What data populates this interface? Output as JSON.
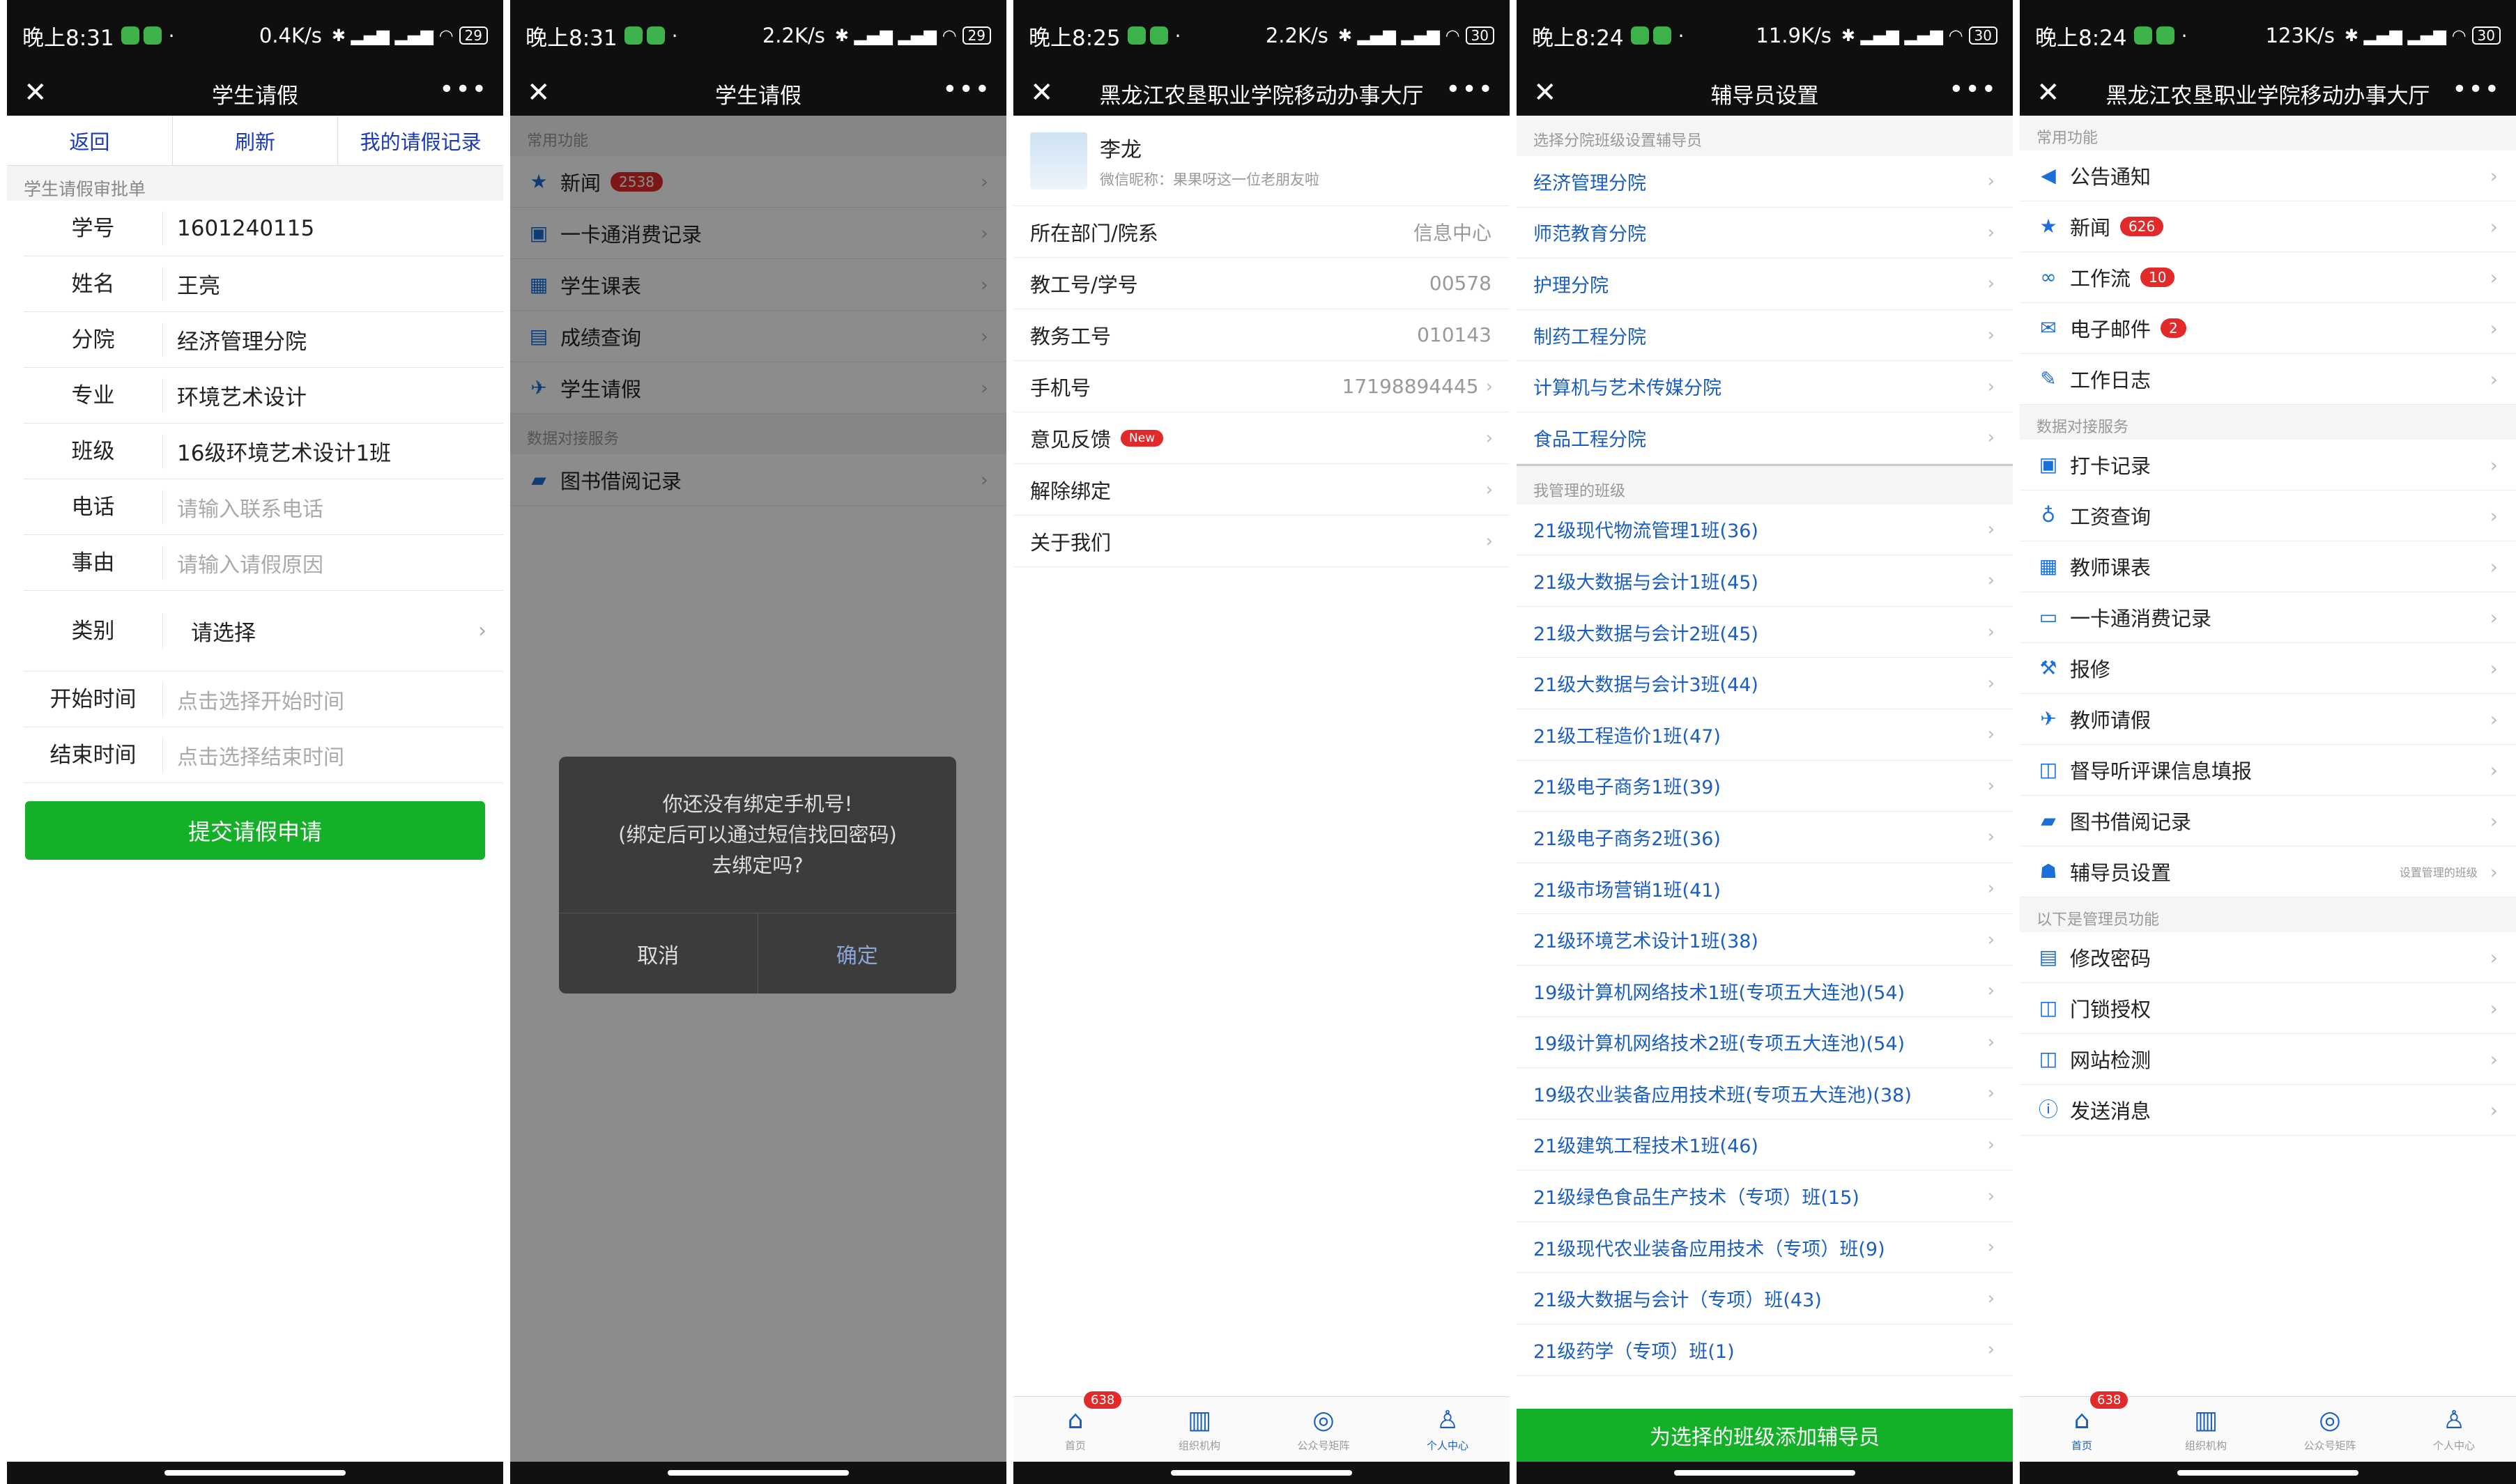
{
  "screens": [
    {
      "status": {
        "time": "晚上8:31",
        "speed": "0.4K/s",
        "battery": "29"
      },
      "nav": {
        "title": "学生请假"
      },
      "buttons": [
        "返回",
        "刷新",
        "我的请假记录"
      ],
      "form_title": "学生请假审批单",
      "fields": {
        "student_id": {
          "label": "学号",
          "value": "1601240115"
        },
        "name": {
          "label": "姓名",
          "value": "王亮"
        },
        "branch": {
          "label": "分院",
          "value": "经济管理分院"
        },
        "major": {
          "label": "专业",
          "value": "环境艺术设计"
        },
        "class": {
          "label": "班级",
          "value": "16级环境艺术设计1班"
        },
        "phone": {
          "label": "电话",
          "placeholder": "请输入联系电话"
        },
        "reason": {
          "label": "事由",
          "placeholder": "请输入请假原因"
        },
        "category": {
          "label": "类别",
          "value": "请选择"
        },
        "start_time": {
          "label": "开始时间",
          "placeholder": "点击选择开始时间"
        },
        "end_time": {
          "label": "结束时间",
          "placeholder": "点击选择结束时间"
        }
      },
      "submit_label": "提交请假申请"
    },
    {
      "status": {
        "time": "晚上8:31",
        "speed": "2.2K/s",
        "battery": "29"
      },
      "nav": {
        "title": "学生请假"
      },
      "section1": "常用功能",
      "items1": [
        {
          "label": "新闻",
          "badge": "2538"
        },
        {
          "label": "一卡通消费记录"
        },
        {
          "label": "学生课表"
        },
        {
          "label": "成绩查询"
        },
        {
          "label": "学生请假"
        }
      ],
      "section2": "数据对接服务",
      "items2": [
        {
          "label": "图书借阅记录"
        }
      ],
      "dialog": {
        "line1": "你还没有绑定手机号!",
        "line2": "(绑定后可以通过短信找回密码)",
        "line3": "去绑定吗?",
        "cancel": "取消",
        "confirm": "确定"
      }
    },
    {
      "status": {
        "time": "晚上8:25",
        "speed": "2.2K/s",
        "battery": "30"
      },
      "nav": {
        "title": "黑龙江农垦职业学院移动办事大厅"
      },
      "profile": {
        "name": "李龙",
        "nickname": "微信昵称：果果呀这一位老朋友啦"
      },
      "rows": [
        {
          "label": "所在部门/院系",
          "value": "信息中心"
        },
        {
          "label": "教工号/学号",
          "value": "00578"
        },
        {
          "label": "教务工号",
          "value": "010143"
        },
        {
          "label": "手机号",
          "value": "17198894445"
        },
        {
          "label": "意见反馈",
          "badge": "New"
        },
        {
          "label": "解除绑定"
        },
        {
          "label": "关于我们"
        }
      ],
      "tabs": [
        {
          "label": "首页",
          "badge": "638"
        },
        {
          "label": "组织机构"
        },
        {
          "label": "公众号矩阵"
        },
        {
          "label": "个人中心"
        }
      ]
    },
    {
      "status": {
        "time": "晚上8:24",
        "speed": "11.9K/s",
        "battery": "30"
      },
      "nav": {
        "title": "辅导员设置"
      },
      "section1": "选择分院班级设置辅导员",
      "branches": [
        "经济管理分院",
        "师范教育分院",
        "护理分院",
        "制药工程分院",
        "计算机与艺术传媒分院",
        "食品工程分院"
      ],
      "section2": "我管理的班级",
      "classes": [
        "21级现代物流管理1班(36)",
        "21级大数据与会计1班(45)",
        "21级大数据与会计2班(45)",
        "21级大数据与会计3班(44)",
        "21级工程造价1班(47)",
        "21级电子商务1班(39)",
        "21级电子商务2班(36)",
        "21级市场营销1班(41)",
        "21级环境艺术设计1班(38)",
        "19级计算机网络技术1班(专项五大连池)(54)",
        "19级计算机网络技术2班(专项五大连池)(54)",
        "19级农业装备应用技术班(专项五大连池)(38)",
        "21级建筑工程技术1班(46)",
        "21级绿色食品生产技术（专项）班(15)",
        "21级现代农业装备应用技术（专项）班(9)",
        "21级大数据与会计（专项）班(43)",
        "21级药学（专项）班(1)"
      ],
      "add_button": "为选择的班级添加辅导员"
    },
    {
      "status": {
        "time": "晚上8:24",
        "speed": "123K/s",
        "battery": "30"
      },
      "nav": {
        "title": "黑龙江农垦职业学院移动办事大厅"
      },
      "section1": "常用功能",
      "items1": [
        {
          "label": "公告通知"
        },
        {
          "label": "新闻",
          "badge": "626"
        },
        {
          "label": "工作流",
          "badge": "10"
        },
        {
          "label": "电子邮件",
          "badge": "2"
        },
        {
          "label": "工作日志"
        }
      ],
      "section2": "数据对接服务",
      "items2": [
        {
          "label": "打卡记录"
        },
        {
          "label": "工资查询"
        },
        {
          "label": "教师课表"
        },
        {
          "label": "一卡通消费记录"
        },
        {
          "label": "报修"
        },
        {
          "label": "教师请假"
        },
        {
          "label": "督导听评课信息填报"
        },
        {
          "label": "图书借阅记录"
        },
        {
          "label": "辅导员设置",
          "hint": "设置管理的班级"
        }
      ],
      "section3": "以下是管理员功能",
      "items3": [
        {
          "label": "修改密码"
        },
        {
          "label": "门锁授权"
        },
        {
          "label": "网站检测"
        },
        {
          "label": "发送消息"
        }
      ],
      "tabs": [
        {
          "label": "首页",
          "badge": "638"
        },
        {
          "label": "组织机构"
        },
        {
          "label": "公众号矩阵"
        },
        {
          "label": "个人中心"
        }
      ]
    }
  ]
}
